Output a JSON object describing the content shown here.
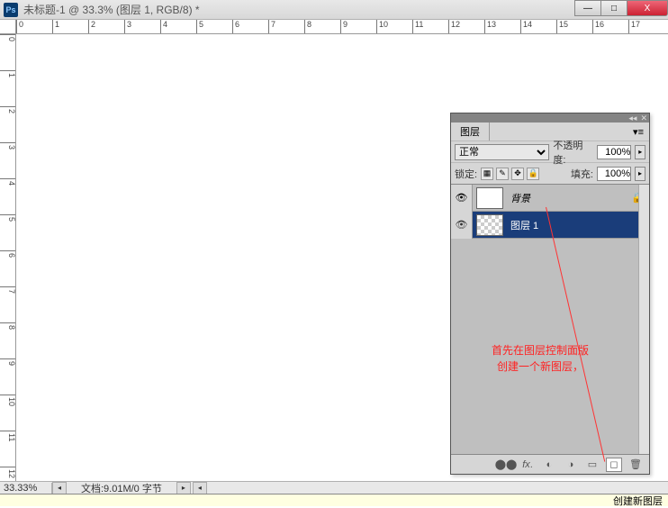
{
  "title": "未标题-1 @ 33.3% (图层 1, RGB/8) *",
  "window_buttons": {
    "min": "—",
    "max": "□",
    "close": "X"
  },
  "ruler_h": [
    "0",
    "1",
    "2",
    "3",
    "4",
    "5",
    "6",
    "7",
    "8",
    "9",
    "10",
    "11",
    "12",
    "13",
    "14",
    "15",
    "16",
    "17"
  ],
  "ruler_v": [
    "0",
    "1",
    "2",
    "3",
    "4",
    "5",
    "6",
    "7",
    "8",
    "9",
    "10",
    "11",
    "12"
  ],
  "statusbar": {
    "zoom": "33.33%",
    "docinfo": "文档:9.01M/0 字节"
  },
  "tooltip": "创建新图层",
  "panel": {
    "title": "图层",
    "blend_mode": "正常",
    "opacity_label": "不透明度:",
    "opacity_value": "100%",
    "lock_label": "锁定:",
    "fill_label": "填充:",
    "fill_value": "100%",
    "layers": [
      {
        "name": "图层 1",
        "selected": true,
        "checker": true,
        "locked": false
      },
      {
        "name": "背景",
        "selected": false,
        "checker": false,
        "locked": true,
        "italic": true
      }
    ],
    "footer_icons": [
      "link",
      "fx",
      "mask",
      "adjust",
      "folder",
      "new",
      "trash"
    ]
  },
  "annotation": {
    "line1": "首先在图层控制面版",
    "line2": "创建一个新图层，"
  }
}
